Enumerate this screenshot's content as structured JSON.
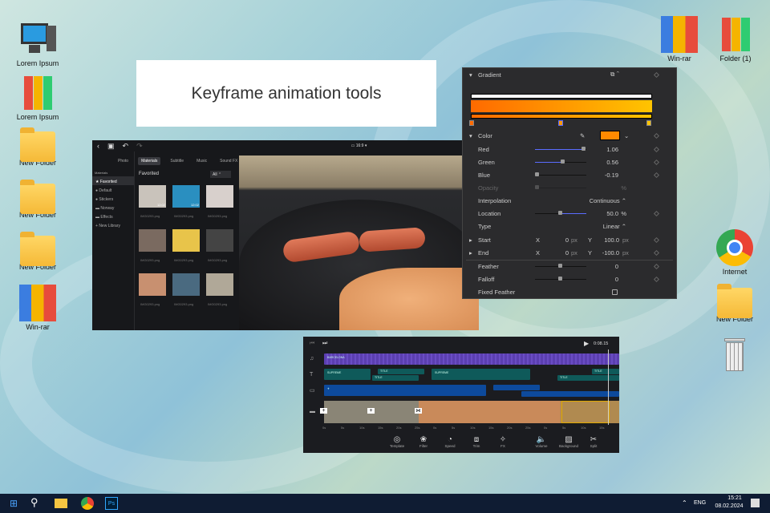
{
  "desktop": {
    "left_icons": [
      {
        "label": "Lorem Ipsum",
        "icon": "computer-icon"
      },
      {
        "label": "Lorem Ipsum",
        "icon": "binders-icon"
      },
      {
        "label": "New Folder",
        "icon": "folder-icon"
      },
      {
        "label": "New Folder",
        "icon": "folder-icon"
      },
      {
        "label": "New Folder",
        "icon": "folder-icon"
      },
      {
        "label": "Win-rar",
        "icon": "winrar-icon"
      }
    ],
    "right_icons": [
      {
        "label": "Win-rar",
        "icon": "winrar-icon"
      },
      {
        "label": "Folder (1)",
        "icon": "binders-icon"
      },
      {
        "label": "Internet",
        "icon": "chrome-icon"
      },
      {
        "label": "New Folder",
        "icon": "folder-icon"
      },
      {
        "label": "",
        "icon": "recycle-bin-icon"
      }
    ]
  },
  "title_card": "Keyframe animation tools",
  "editor": {
    "aspect": "16:9",
    "tabs": [
      "Photo",
      "Materials",
      "Subtitle",
      "Music",
      "Sound FX"
    ],
    "active_tab": "Materials",
    "sidebar_heading": "Materials",
    "sidebar": [
      "Favorited",
      "Default",
      "Stickers",
      "Norway",
      "Effects",
      "New Library"
    ],
    "section": "Favorited",
    "filter": "All",
    "thumbs": [
      {
        "name": "IMG0293.png",
        "duration": "12:02"
      },
      {
        "name": "IMG0293.png",
        "duration": "12:02"
      },
      {
        "name": "IMG0293.png"
      },
      {
        "name": "IMG0293.png"
      },
      {
        "name": "IMG0293.png"
      },
      {
        "name": "IMG0293.png"
      },
      {
        "name": "IMG0293.png"
      },
      {
        "name": "IMG0293.png"
      },
      {
        "name": "IMG0293.png"
      }
    ]
  },
  "gradient_panel": {
    "title": "Gradient",
    "color_label": "Color",
    "swatch": "#ff8a00",
    "rows": [
      {
        "label": "Red",
        "value": "1.06",
        "fill": 0.95
      },
      {
        "label": "Green",
        "value": "0.56",
        "fill": 0.55
      },
      {
        "label": "Blue",
        "value": "-0.19",
        "fill": 0.02
      },
      {
        "label": "Opacity",
        "value": "%"
      }
    ],
    "interpolation": {
      "label": "Interpolation",
      "value": "Continuous ⌃"
    },
    "location": {
      "label": "Location",
      "value": "50.0",
      "unit": "%",
      "fill": 0.5
    },
    "type": {
      "label": "Type",
      "value": "Linear ⌃"
    },
    "start": {
      "label": "Start",
      "x": "0",
      "y": "100.0",
      "unit": "px"
    },
    "end": {
      "label": "End",
      "x": "0",
      "y": "-100.0",
      "unit": "px"
    },
    "feather": {
      "label": "Feather",
      "value": "0"
    },
    "falloff": {
      "label": "Falloff",
      "value": "0"
    },
    "fixed_feather": {
      "label": "Fixed Feather",
      "checked": false
    }
  },
  "timeline": {
    "time": "0:08.15",
    "audio": "BARCELONA",
    "titles": [
      "SUPREME",
      "TITLE",
      "TITLE",
      "SUPREME",
      "TITLE",
      "TITLE"
    ],
    "ticks": [
      "0s",
      "5s",
      "10s",
      "15s",
      "20s",
      "25s",
      "0s",
      "5s",
      "10s",
      "15s",
      "20s",
      "25s",
      "0s",
      "5s",
      "10s",
      "15s"
    ],
    "tools": [
      {
        "label": "Template",
        "icon": "◎"
      },
      {
        "label": "Filter",
        "icon": "❀"
      },
      {
        "label": "Speed",
        "icon": "◔"
      },
      {
        "label": "Trim",
        "icon": "⧈"
      },
      {
        "label": "FX",
        "icon": "✧"
      },
      {
        "label": "Volume",
        "icon": "🔈"
      },
      {
        "label": "Background",
        "icon": "▨"
      },
      {
        "label": "Split",
        "icon": "✂"
      }
    ]
  },
  "taskbar": {
    "lang": "ENG",
    "time": "15:21",
    "date": "08.02.2024"
  }
}
